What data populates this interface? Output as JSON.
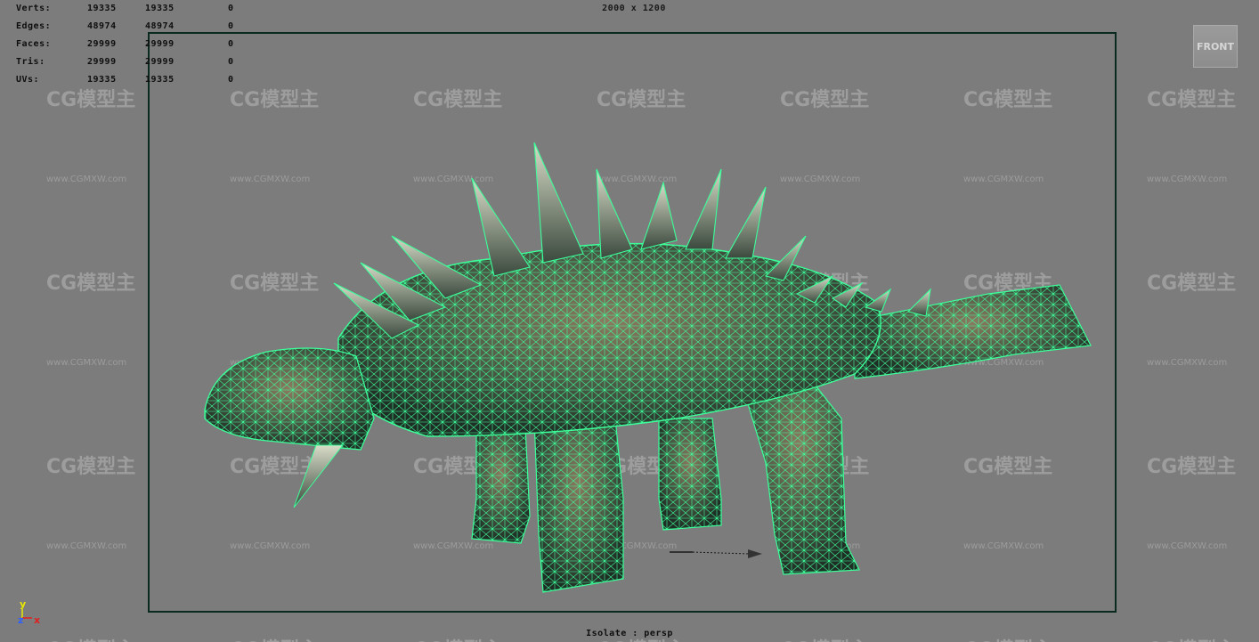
{
  "viewport": {
    "resolution": "2000 x 1200",
    "isolate_label": "Isolate : persp",
    "view_cube_label": "FRONT"
  },
  "stats": [
    {
      "label": "Verts:",
      "c1": "19335",
      "c2": "19335",
      "c3": "0"
    },
    {
      "label": "Edges:",
      "c1": "48974",
      "c2": "48974",
      "c3": "0"
    },
    {
      "label": "Faces:",
      "c1": "29999",
      "c2": "29999",
      "c3": "0"
    },
    {
      "label": "Tris:",
      "c1": "29999",
      "c2": "29999",
      "c3": "0"
    },
    {
      "label": "UVs:",
      "c1": "19335",
      "c2": "19335",
      "c3": "0"
    }
  ],
  "axis": {
    "y": "y",
    "z": "z",
    "x": "x"
  },
  "watermark": {
    "brand": "CG模型主",
    "url": "www.CGMXW.com"
  },
  "colors": {
    "background": "#7b7c7b",
    "wireframe": "#3cff9a",
    "gate_border": "#0b2a1f",
    "axis_y": "#e8e800",
    "axis_x": "#e02020",
    "axis_z": "#3060ff"
  }
}
